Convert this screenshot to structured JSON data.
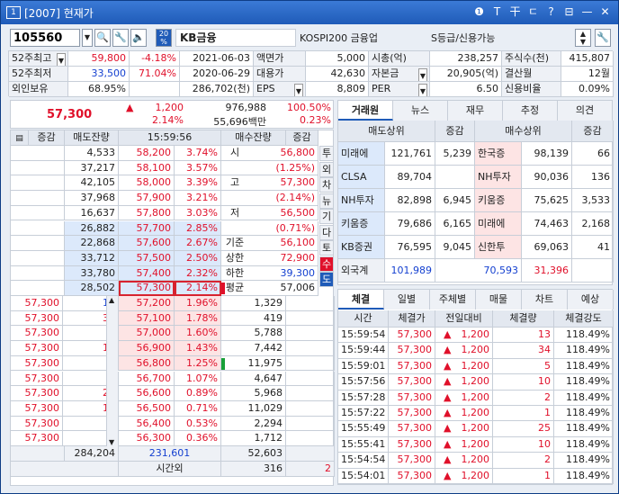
{
  "window": {
    "title_num": "1",
    "title": "[2007] 현재가",
    "btns": [
      "❶",
      "T",
      "干",
      "ㄷ",
      "?",
      "⊟",
      "—",
      "✕"
    ]
  },
  "topbar": {
    "code": "105560",
    "name": "KB금융",
    "market": "KOSPI200 금융업",
    "grade": "S등급/신용가능"
  },
  "info": [
    [
      "52주최고",
      "59,800",
      "-4.18%",
      "2021-06-03",
      "액면가",
      "5,000",
      "시총(억)",
      "238,257",
      "주식수(천)",
      "415,807"
    ],
    [
      "52주최저",
      "33,500",
      "71.04%",
      "2020-06-29",
      "대용가",
      "42,630",
      "자본금",
      "20,905(억)",
      "결산월",
      "12월"
    ],
    [
      "외인보유",
      "68.95%",
      "",
      "286,702(천)",
      "EPS",
      "8,809",
      "PER",
      "6.50",
      "신용비율",
      "0.09%"
    ]
  ],
  "summary": {
    "price": "57,300",
    "change": "1,200",
    "volume": "976,988",
    "vol_ratio": "100.50%",
    "rate": "2.14%",
    "amount": "55,696백만",
    "turnover": "0.23%"
  },
  "book_hdr": [
    "증감",
    "매도잔량",
    "15:59:56",
    "매수잔량",
    "증감"
  ],
  "asks": [
    [
      "4,533",
      "58,200",
      "3.74%"
    ],
    [
      "37,217",
      "58,100",
      "3.57%"
    ],
    [
      "42,105",
      "58,000",
      "3.39%"
    ],
    [
      "37,968",
      "57,900",
      "3.21%"
    ],
    [
      "16,637",
      "57,800",
      "3.03%"
    ],
    [
      "26,882",
      "57,700",
      "2.85%"
    ],
    [
      "22,868",
      "57,600",
      "2.67%"
    ],
    [
      "33,712",
      "57,500",
      "2.50%"
    ],
    [
      "33,780",
      "57,400",
      "2.32%"
    ],
    [
      "28,502",
      "57,300",
      "2.14%"
    ]
  ],
  "bids": [
    [
      "57,300",
      "13",
      "57,200",
      "1.96%",
      "1,329"
    ],
    [
      "57,300",
      "34",
      "57,100",
      "1.78%",
      "419"
    ],
    [
      "57,300",
      "5",
      "57,000",
      "1.60%",
      "5,788"
    ],
    [
      "57,300",
      "10",
      "56,900",
      "1.43%",
      "7,442"
    ],
    [
      "57,300",
      "2",
      "56,800",
      "1.25%",
      "11,975"
    ],
    [
      "57,300",
      "1",
      "56,700",
      "1.07%",
      "4,647"
    ],
    [
      "57,300",
      "25",
      "56,600",
      "0.89%",
      "5,968"
    ],
    [
      "57,300",
      "10",
      "56,500",
      "0.71%",
      "11,029"
    ],
    [
      "57,300",
      "2",
      "56,400",
      "0.53%",
      "2,294"
    ],
    [
      "57,300",
      "1",
      "56,300",
      "0.36%",
      "1,712"
    ]
  ],
  "stats": [
    [
      "시",
      "56,800"
    ],
    [
      "",
      "(1.25%)"
    ],
    [
      "고",
      "57,300"
    ],
    [
      "",
      "(2.14%)"
    ],
    [
      "저",
      "56,500"
    ],
    [
      "",
      "(0.71%)"
    ],
    [
      "기준",
      "56,100"
    ],
    [
      "상한",
      "72,900"
    ],
    [
      "하한",
      "39,300"
    ],
    [
      "평균",
      "57,006"
    ]
  ],
  "vtabs": [
    "투",
    "외",
    "차",
    "뉴",
    "기",
    "다",
    "토",
    "수",
    "도"
  ],
  "totals": {
    "ask": "284,204",
    "diff": "231,601",
    "bid": "52,603",
    "after_label": "시간외",
    "after_ask": "316",
    "after_bid": "2"
  },
  "rtabs": [
    "거래원",
    "뉴스",
    "재무",
    "추정",
    "의견"
  ],
  "broker_hdr": [
    "매도상위",
    "증감",
    "매수상위",
    "증감"
  ],
  "brokers": [
    [
      "미래에",
      "121,761",
      "5,239",
      "한국증",
      "98,139",
      "66"
    ],
    [
      "CLSA",
      "89,704",
      "",
      "NH투자",
      "90,036",
      "136"
    ],
    [
      "NH투자",
      "82,898",
      "6,945",
      "키움증",
      "75,625",
      "3,533"
    ],
    [
      "키움증",
      "79,686",
      "6,165",
      "미래에",
      "74,463",
      "2,168"
    ],
    [
      "KB증권",
      "76,595",
      "9,045",
      "신한투",
      "69,063",
      "41"
    ]
  ],
  "foreign": [
    "외국계",
    "101,989",
    "70,593",
    "31,396"
  ],
  "ttabs": [
    "체결",
    "일별",
    "주체별",
    "매물",
    "차트",
    "예상"
  ],
  "trade_hdr": [
    "시간",
    "체결가",
    "전일대비",
    "체결량",
    "체결강도"
  ],
  "trades": [
    [
      "15:59:54",
      "57,300",
      "▲",
      "1,200",
      "13",
      "118.49%"
    ],
    [
      "15:59:44",
      "57,300",
      "▲",
      "1,200",
      "34",
      "118.49%"
    ],
    [
      "15:59:01",
      "57,300",
      "▲",
      "1,200",
      "5",
      "118.49%"
    ],
    [
      "15:57:56",
      "57,300",
      "▲",
      "1,200",
      "10",
      "118.49%"
    ],
    [
      "15:57:28",
      "57,300",
      "▲",
      "1,200",
      "2",
      "118.49%"
    ],
    [
      "15:57:22",
      "57,300",
      "▲",
      "1,200",
      "1",
      "118.49%"
    ],
    [
      "15:55:49",
      "57,300",
      "▲",
      "1,200",
      "25",
      "118.49%"
    ],
    [
      "15:55:41",
      "57,300",
      "▲",
      "1,200",
      "10",
      "118.49%"
    ],
    [
      "15:54:54",
      "57,300",
      "▲",
      "1,200",
      "2",
      "118.49%"
    ],
    [
      "15:54:01",
      "57,300",
      "▲",
      "1,200",
      "1",
      "118.49%"
    ]
  ],
  "colors": {
    "up": "#e0102a",
    "down": "#1440d0",
    "accent": "#1f5bb8"
  }
}
